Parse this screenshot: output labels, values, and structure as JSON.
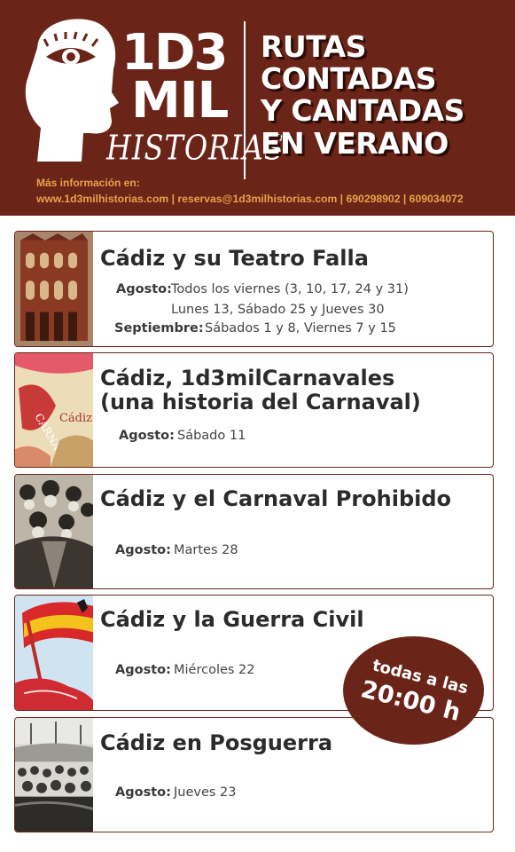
{
  "brand": {
    "line1": "1D3",
    "line2": "MIL",
    "line3": "HISTORIAS"
  },
  "title": {
    "line1": "RUTAS",
    "line2": "CONTADAS",
    "line3": "Y CANTADAS",
    "line4": "EN VERANO"
  },
  "info": {
    "label": "Más información en:",
    "line": "www.1d3milhistorias.com | reservas@1d3milhistorias.com | 690298902 | 609034072"
  },
  "routes": [
    {
      "title": "Cádiz y su Teatro Falla",
      "agosto_label": "Agosto:",
      "agosto_1": "Todos los viernes (3, 10, 17, 24 y 31)",
      "agosto_2": "Lunes 13, Sábado 25 y Jueves 30",
      "sept_label": "Septiembre:",
      "sept_1": "Sábados 1 y 8, Viernes 7 y 15"
    },
    {
      "title_1": "Cádiz, 1d3milCarnavales",
      "title_2": "(una historia del Carnaval)",
      "agosto_label": "Agosto:",
      "agosto_1": "Sábado 11"
    },
    {
      "title": "Cádiz y el Carnaval Prohibido",
      "agosto_label": "Agosto:",
      "agosto_1": "Martes 28"
    },
    {
      "title": "Cádiz y la Guerra Civil",
      "agosto_label": "Agosto:",
      "agosto_1": "Miércoles 22"
    },
    {
      "title": "Cádiz en Posguerra",
      "agosto_label": "Agosto:",
      "agosto_1": "Jueves 23"
    }
  ],
  "badge": {
    "line1": "todas a las",
    "line2": "20:00 h"
  },
  "colors": {
    "brand_red": "#6b2418",
    "accent_orange": "#e7a24a",
    "text_dark": "#2b2b2b"
  }
}
